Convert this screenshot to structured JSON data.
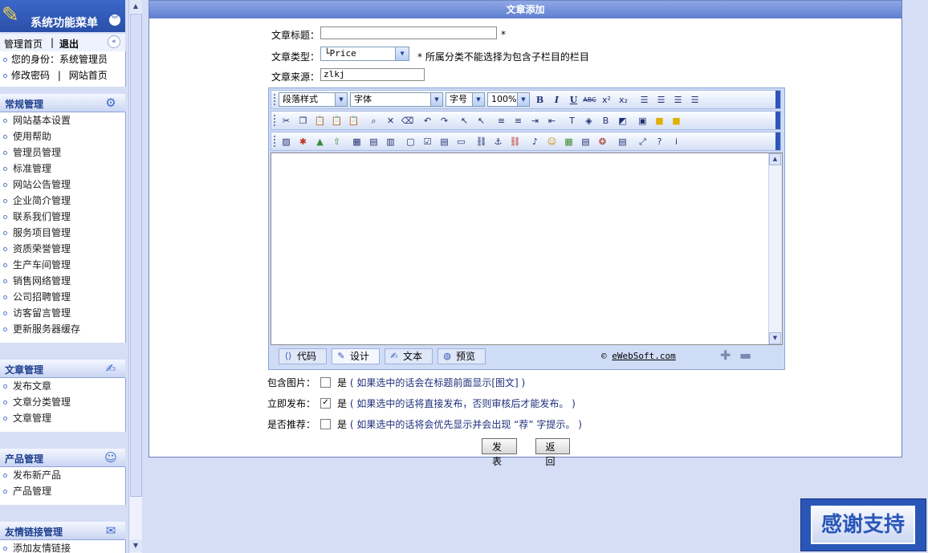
{
  "sidebar": {
    "header_title": "系统功能菜单",
    "top_links": {
      "home": "管理首页",
      "sep": "|",
      "logout": "退出"
    },
    "user_info": {
      "identity": "您的身份：系统管理员",
      "change_password": "修改密码",
      "sep": "|",
      "site_home": "网站首页"
    },
    "groups": [
      {
        "title": "常规管理",
        "icon": "settings-icon",
        "items": [
          "网站基本设置",
          "使用帮助",
          "管理员管理",
          "标准管理",
          "网站公告管理",
          "企业简介管理",
          "联系我们管理",
          "服务项目管理",
          "资质荣誉管理",
          "生产车间管理",
          "销售网络管理",
          "公司招聘管理",
          "访客留言管理",
          "更新服务器缓存"
        ]
      },
      {
        "title": "文章管理",
        "icon": "edit-icon",
        "items": [
          "发布文章",
          "文章分类管理",
          "文章管理"
        ]
      },
      {
        "title": "产品管理",
        "icon": "user-icon",
        "items": [
          "发布新产品",
          "产品管理"
        ]
      },
      {
        "title": "友情链接管理",
        "icon": "link-icon",
        "items": [
          "添加友情链接"
        ]
      }
    ]
  },
  "main": {
    "title": "文章添加",
    "fields": {
      "title_label": "文章标题：",
      "title_value": "",
      "required_mark": "*",
      "type_label": "文章类型：",
      "type_value": "└Price",
      "type_note": "* 所属分类不能选择为包含子栏目的栏目",
      "source_label": "文章来源：",
      "source_value": "zlkj"
    },
    "editor": {
      "paragraph_style": "段落样式",
      "font": "字体",
      "font_size": "字号",
      "zoom": "100%",
      "mode_tabs": [
        "代码",
        "设计",
        "文本",
        "预览"
      ],
      "active_tab": "设计",
      "credit_prefix": "©",
      "credit_link": "eWebSoft.com"
    },
    "options": [
      {
        "label": "包含图片：",
        "checked": false,
        "yes": "是",
        "note": "( 如果选中的话会在标题前面显示[图文] )"
      },
      {
        "label": "立即发布：",
        "checked": true,
        "yes": "是",
        "note": "( 如果选中的话将直接发布，否则审核后才能发布。 )"
      },
      {
        "label": "是否推荐：",
        "checked": false,
        "yes": "是",
        "note": "( 如果选中的话将会优先显示并会出现 “荐” 字提示。 )"
      }
    ],
    "buttons": {
      "submit": "发表",
      "back": "返回"
    }
  },
  "thanks_banner": "感谢支持"
}
